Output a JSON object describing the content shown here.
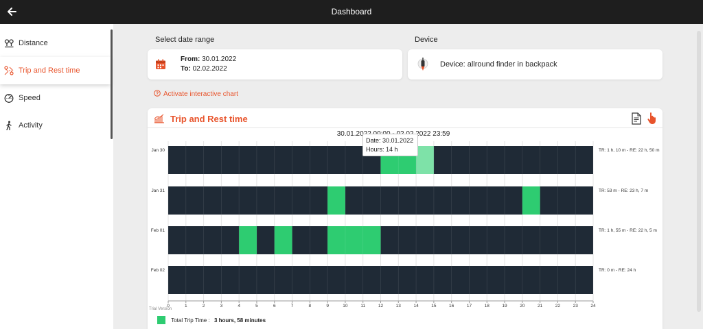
{
  "header": {
    "title": "Dashboard"
  },
  "sidebar": {
    "items": [
      {
        "label": "Distance",
        "icon": "map-pins-icon",
        "active": false
      },
      {
        "label": "Trip and Rest time",
        "icon": "route-icon",
        "active": true
      },
      {
        "label": "Speed",
        "icon": "speedometer-icon",
        "active": false
      },
      {
        "label": "Activity",
        "icon": "walking-person-icon",
        "active": false
      }
    ]
  },
  "date_range": {
    "label": "Select date range",
    "from_label": "From:",
    "from_value": "30.01.2022",
    "to_label": "To:",
    "to_value": "02.02.2022"
  },
  "device": {
    "label": "Device",
    "text": "Device: allround finder in backpack"
  },
  "activate_link": "Activate interactive chart",
  "chart_section": {
    "title": "Trip and Rest time"
  },
  "tooltip": {
    "date_label": "Date:",
    "date_value": "30.01.2022",
    "hours_label": "Hours:",
    "hours_value": "14 h"
  },
  "legend": {
    "label": "Total Trip Time :",
    "value": "3 hours, 58 minutes"
  },
  "colors": {
    "accent": "#e8542c",
    "rest": "#1f2a36",
    "trip": "#2ecc71",
    "trip_highlight": "#7ee2a8"
  },
  "chart_data": {
    "type": "heatmap",
    "title": "30.01.2022 00:00 - 02.02.2022 23:59",
    "watermark": "Trial Version",
    "x_ticks": [
      "0",
      "1",
      "2",
      "3",
      "4",
      "5",
      "6",
      "7",
      "8",
      "9",
      "10",
      "11",
      "12",
      "13",
      "14",
      "15",
      "16",
      "17",
      "18",
      "19",
      "20",
      "21",
      "22",
      "23",
      "24"
    ],
    "xlim": [
      0,
      24
    ],
    "rows": [
      {
        "day": "Jan 30",
        "summary": "TR: 1 h, 10 m - RE: 22 h, 50 m",
        "trip_intervals": [
          [
            12,
            14
          ],
          [
            14,
            15
          ]
        ],
        "highlight_interval": [
          14,
          15
        ]
      },
      {
        "day": "Jan 31",
        "summary": "TR: 53 m - RE: 23 h, 7 m",
        "trip_intervals": [
          [
            9,
            10
          ],
          [
            20,
            21
          ]
        ]
      },
      {
        "day": "Feb 01",
        "summary": "TR: 1 h, 55 m - RE: 22 h, 5 m",
        "trip_intervals": [
          [
            4,
            5
          ],
          [
            6,
            7
          ],
          [
            9,
            12
          ]
        ]
      },
      {
        "day": "Feb 02",
        "summary": "TR: 0 m - RE: 24 h",
        "trip_intervals": []
      }
    ]
  }
}
